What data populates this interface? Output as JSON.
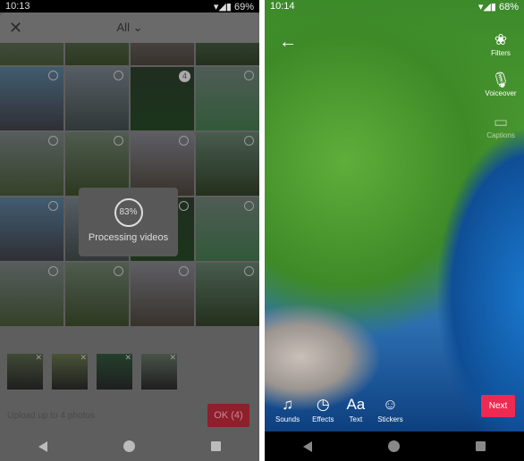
{
  "left": {
    "status": {
      "time": "10:13",
      "battery": "69%"
    },
    "header": {
      "close_icon": "close-icon",
      "filter_label": "All"
    },
    "selected_badge": "4",
    "processing": {
      "percent": "83%",
      "label": "Processing videos",
      "progress": 0.83
    },
    "selected_thumbs": 4,
    "hint": "Upload up to 4 photos",
    "ok_button": "OK (4)"
  },
  "right": {
    "status": {
      "time": "10:14",
      "battery": "68%"
    },
    "side_tools": [
      {
        "label": "Filters",
        "icon": "filters-icon"
      },
      {
        "label": "Voiceover",
        "icon": "microphone-icon"
      },
      {
        "label": "Captions",
        "icon": "captions-icon"
      }
    ],
    "bottom_tools": [
      {
        "label": "Sounds",
        "icon": "music-note-icon"
      },
      {
        "label": "Effects",
        "icon": "effects-icon"
      },
      {
        "label": "Text",
        "icon": "text-icon"
      },
      {
        "label": "Stickers",
        "icon": "sticker-icon"
      }
    ],
    "next_button": "Next",
    "accent": "#ee2a53"
  }
}
